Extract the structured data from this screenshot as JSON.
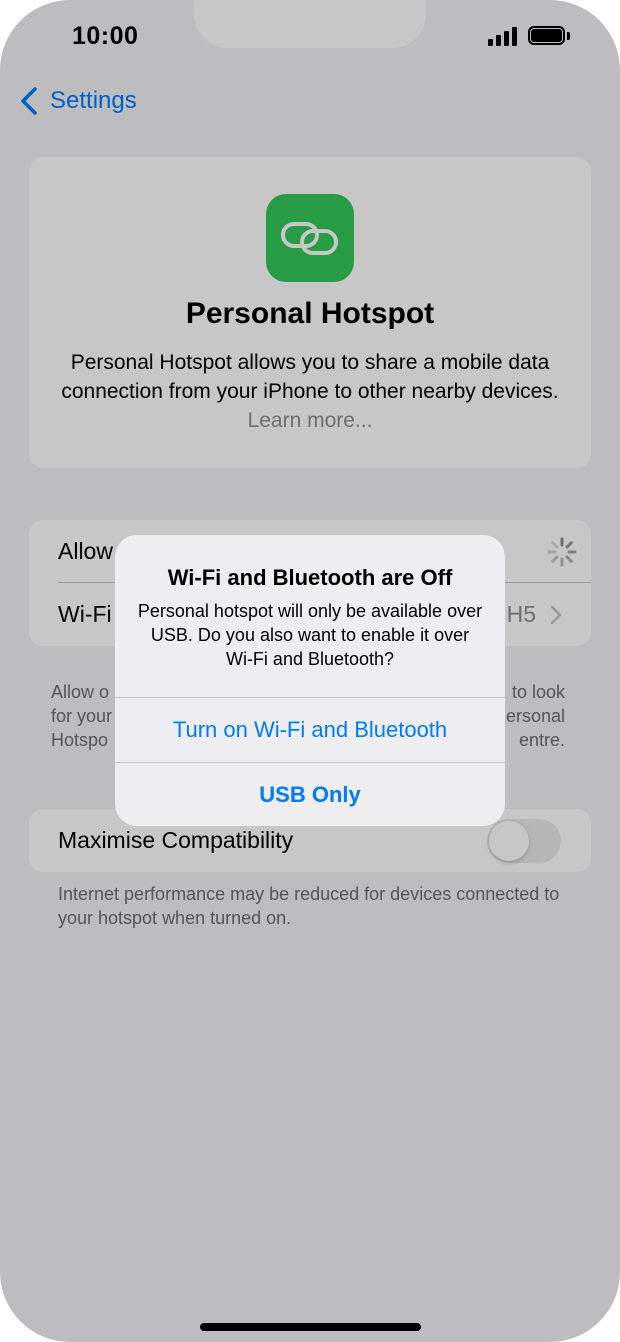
{
  "status_bar": {
    "time": "10:00"
  },
  "nav": {
    "back_label": "Settings"
  },
  "hero": {
    "icon": "link-chain-icon",
    "title": "Personal Hotspot",
    "description": "Personal Hotspot allows you to share a mobile data connection from your iPhone to other nearby devices.",
    "learn_more": "Learn more..."
  },
  "settings": {
    "allow_label": "Allow",
    "wifi_label": "Wi-Fi",
    "wifi_value": "H5"
  },
  "footer_note": {
    "line1_left": "Allow o",
    "line1_right": "to look",
    "line2_left": "for your",
    "line2_right": "ersonal",
    "line3_left": "Hotspo",
    "line3_right": "entre."
  },
  "compat": {
    "label": "Maximise Compatibility",
    "toggle_on": false,
    "note": "Internet performance may be reduced for devices connected to your hotspot when turned on."
  },
  "alert": {
    "title": "Wi-Fi and Bluetooth are Off",
    "message": "Personal hotspot will only be available over USB. Do you also want to enable it over Wi-Fi and Bluetooth?",
    "primary_button": "Turn on Wi-Fi and Bluetooth",
    "secondary_button": "USB Only"
  },
  "colors": {
    "accent": "#007aff",
    "app_icon": "#34c759",
    "dim": "rgba(0,0,0,0.22)"
  }
}
